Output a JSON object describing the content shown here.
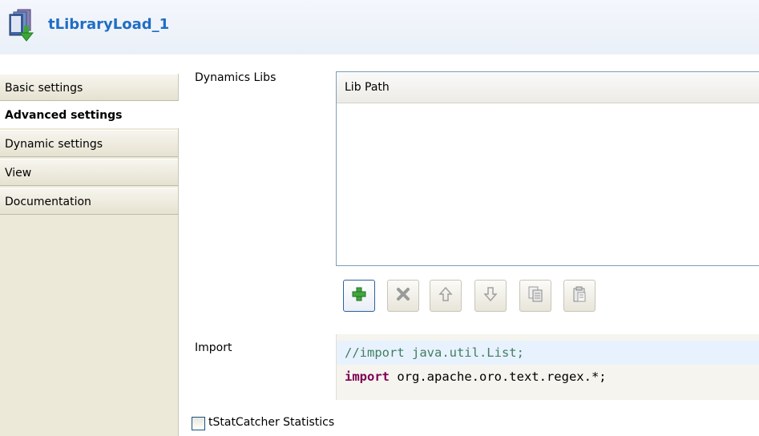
{
  "header": {
    "title": "tLibraryLoad_1",
    "icon": "library-load-icon"
  },
  "sidebar": {
    "tabs": [
      {
        "label": "Basic settings",
        "active": false
      },
      {
        "label": "Advanced settings",
        "active": true
      },
      {
        "label": "Dynamic settings",
        "active": false
      },
      {
        "label": "View",
        "active": false
      },
      {
        "label": "Documentation",
        "active": false
      }
    ]
  },
  "main": {
    "dynamics_libs_label": "Dynamics Libs",
    "table": {
      "columns": [
        "Lib Path"
      ],
      "rows": []
    },
    "toolbar": {
      "buttons": [
        "add-icon",
        "delete-icon",
        "move-up-icon",
        "move-down-icon",
        "copy-icon",
        "paste-icon"
      ]
    },
    "import_label": "Import",
    "import_code": {
      "line1": "//import java.util.List;",
      "line2_keyword": "import",
      "line2_rest": " org.apache.oro.text.regex.*;"
    },
    "stat_catcher": {
      "label": "tStatCatcher Statistics",
      "checked": false
    }
  },
  "colors": {
    "title": "#1f6ec4",
    "sidebar_bg": "#ece9d8",
    "comment": "#3f7f5f",
    "keyword": "#7f0055",
    "add_icon": "#3fa83a"
  }
}
